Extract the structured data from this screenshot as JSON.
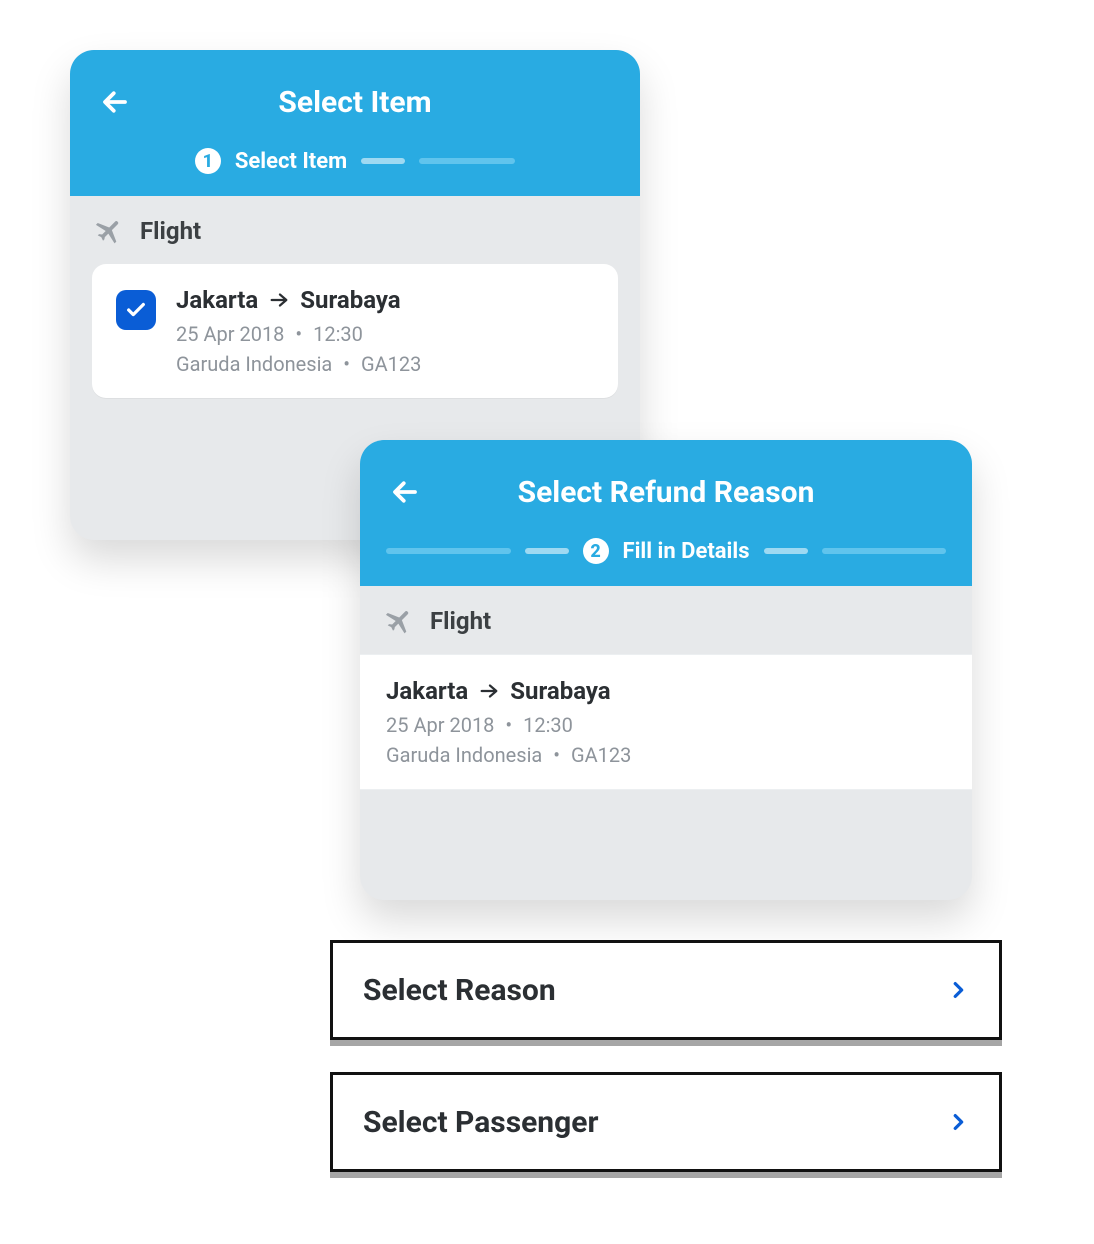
{
  "colors": {
    "brand": "#29abe2",
    "accent": "#0a5dd6"
  },
  "card1": {
    "title": "Select Item",
    "step_index": "1",
    "step_label": "Select Item",
    "section_label": "Flight",
    "flight": {
      "from": "Jakarta",
      "to": "Surabaya",
      "date": "25 Apr 2018",
      "time": "12:30",
      "airline": "Garuda Indonesia",
      "code": "GA123",
      "checked": true
    }
  },
  "card2": {
    "title": "Select Refund Reason",
    "step_index": "2",
    "step_label": "Fill in Details",
    "section_label": "Flight",
    "flight": {
      "from": "Jakarta",
      "to": "Surabaya",
      "date": "25 Apr 2018",
      "time": "12:30",
      "airline": "Garuda Indonesia",
      "code": "GA123"
    }
  },
  "actions": {
    "select_reason": "Select Reason",
    "select_passenger": "Select Passenger"
  }
}
